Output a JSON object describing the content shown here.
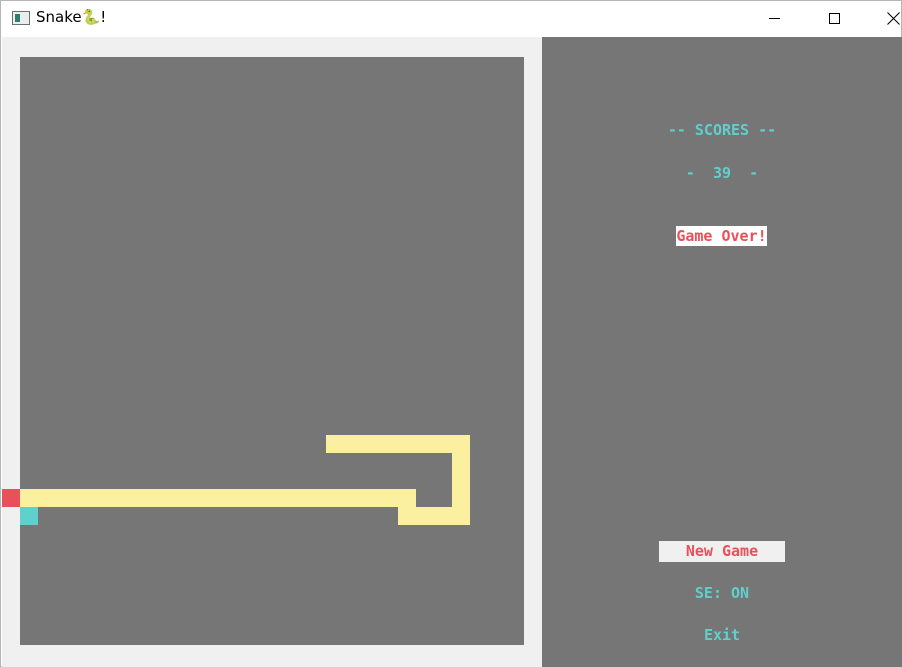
{
  "window": {
    "title": "Snake🐍!",
    "controls": [
      "minimize",
      "maximize",
      "close"
    ]
  },
  "icons": {
    "app": "app-window-icon",
    "minimize": "minimize-icon",
    "maximize": "maximize-icon",
    "close": "close-icon"
  },
  "colors": {
    "board_bg": "#767676",
    "frame_bg": "#f0f0f0",
    "snake": "#faf0a0",
    "snake_head": "#e9505a",
    "food": "#5fd0cc",
    "accent_text": "#5fd0cc",
    "alert_text": "#e9505a"
  },
  "score_panel": {
    "label": "-- SCORES --",
    "value": "-  39  -",
    "status": "Game Over!"
  },
  "menu": {
    "items": [
      {
        "label": "New Game",
        "selected": true
      },
      {
        "label": "SE: ON",
        "selected": false
      },
      {
        "label": "Exit",
        "selected": false
      }
    ]
  },
  "game": {
    "grid_cols": 28,
    "grid_rows": 33,
    "snake_cells": [
      [
        17,
        21
      ],
      [
        18,
        21
      ],
      [
        19,
        21
      ],
      [
        20,
        21
      ],
      [
        21,
        21
      ],
      [
        22,
        21
      ],
      [
        23,
        21
      ],
      [
        24,
        21
      ],
      [
        24,
        22
      ],
      [
        24,
        23
      ],
      [
        24,
        24
      ],
      [
        24,
        25
      ],
      [
        23,
        25
      ],
      [
        22,
        25
      ],
      [
        21,
        25
      ],
      [
        21,
        24
      ],
      [
        20,
        24
      ],
      [
        19,
        24
      ],
      [
        18,
        24
      ],
      [
        17,
        24
      ],
      [
        16,
        24
      ],
      [
        15,
        24
      ],
      [
        14,
        24
      ],
      [
        13,
        24
      ],
      [
        12,
        24
      ],
      [
        11,
        24
      ],
      [
        10,
        24
      ],
      [
        9,
        24
      ],
      [
        8,
        24
      ],
      [
        7,
        24
      ],
      [
        6,
        24
      ],
      [
        5,
        24
      ],
      [
        4,
        24
      ],
      [
        3,
        24
      ],
      [
        2,
        24
      ],
      [
        1,
        24
      ],
      [
        0,
        24
      ]
    ],
    "snake_head_cell": [
      -1,
      24
    ],
    "food_cell": [
      0,
      25
    ]
  }
}
